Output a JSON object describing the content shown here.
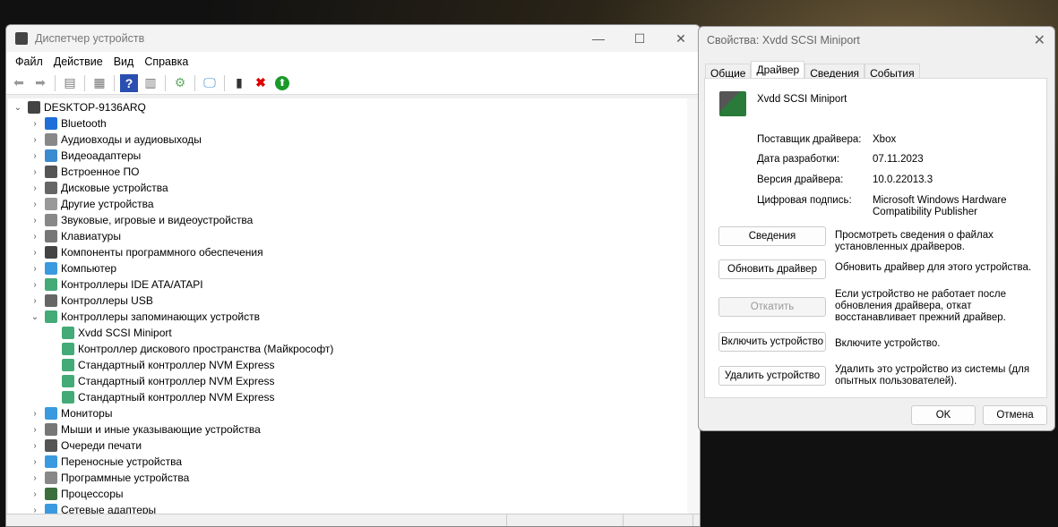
{
  "devmgr": {
    "title": "Диспетчер устройств",
    "menu": [
      "Файл",
      "Действие",
      "Вид",
      "Справка"
    ],
    "root": "DESKTOP-9136ARQ",
    "categories": [
      {
        "label": "Bluetooth",
        "icon": "bluetooth-icon",
        "color": "#1e6fd9"
      },
      {
        "label": "Аудиовходы и аудиовыходы",
        "icon": "speaker-icon",
        "color": "#888"
      },
      {
        "label": "Видеоадаптеры",
        "icon": "monitor-icon",
        "color": "#3a8bd0"
      },
      {
        "label": "Встроенное ПО",
        "icon": "chip-icon",
        "color": "#555"
      },
      {
        "label": "Дисковые устройства",
        "icon": "disk-icon",
        "color": "#666"
      },
      {
        "label": "Другие устройства",
        "icon": "unknown-device-icon",
        "color": "#999"
      },
      {
        "label": "Звуковые, игровые и видеоустройства",
        "icon": "speaker-icon",
        "color": "#888"
      },
      {
        "label": "Клавиатуры",
        "icon": "keyboard-icon",
        "color": "#777"
      },
      {
        "label": "Компоненты программного обеспечения",
        "icon": "software-icon",
        "color": "#444"
      },
      {
        "label": "Компьютер",
        "icon": "computer-icon",
        "color": "#3a9ae0"
      },
      {
        "label": "Контроллеры IDE ATA/ATAPI",
        "icon": "controller-icon",
        "color": "#4a7"
      },
      {
        "label": "Контроллеры USB",
        "icon": "usb-icon",
        "color": "#666"
      },
      {
        "label": "Контроллеры запоминающих устройств",
        "icon": "storage-controller-icon",
        "color": "#4a7",
        "expanded": true
      },
      {
        "label": "Мониторы",
        "icon": "monitor-icon",
        "color": "#3a9ae0"
      },
      {
        "label": "Мыши и иные указывающие устройства",
        "icon": "mouse-icon",
        "color": "#777"
      },
      {
        "label": "Очереди печати",
        "icon": "printer-icon",
        "color": "#555"
      },
      {
        "label": "Переносные устройства",
        "icon": "portable-device-icon",
        "color": "#3a9ae0"
      },
      {
        "label": "Программные устройства",
        "icon": "software-device-icon",
        "color": "#888"
      },
      {
        "label": "Процессоры",
        "icon": "cpu-icon",
        "color": "#3c6e3c"
      },
      {
        "label": "Сетевые адаптеры",
        "icon": "network-icon",
        "color": "#3a9ae0"
      }
    ],
    "storage_children": [
      "Xvdd SCSI Miniport",
      "Контроллер дискового пространства (Майкрософт)",
      "Стандартный контроллер NVM Express",
      "Стандартный контроллер NVM Express",
      "Стандартный контроллер NVM Express"
    ]
  },
  "props": {
    "title": "Свойства: Xvdd SCSI Miniport",
    "tabs": [
      "Общие",
      "Драйвер",
      "Сведения",
      "События"
    ],
    "active_tab": "Драйвер",
    "device_name": "Xvdd SCSI Miniport",
    "fields": [
      {
        "label": "Поставщик драйвера:",
        "value": "Xbox"
      },
      {
        "label": "Дата разработки:",
        "value": "07.11.2023"
      },
      {
        "label": "Версия драйвера:",
        "value": "10.0.22013.3"
      },
      {
        "label": "Цифровая подпись:",
        "value": "Microsoft Windows Hardware Compatibility Publisher"
      }
    ],
    "actions": [
      {
        "button": "Сведения",
        "desc": "Просмотреть сведения о файлах установленных драйверов."
      },
      {
        "button": "Обновить драйвер",
        "desc": "Обновить драйвер для этого устройства."
      },
      {
        "button": "Откатить",
        "desc": "Если устройство не работает после обновления драйвера, откат восстанавливает прежний драйвер.",
        "disabled": true
      },
      {
        "button": "Включить устройство",
        "desc": "Включите устройство."
      },
      {
        "button": "Удалить устройство",
        "desc": "Удалить это устройство из системы (для опытных пользователей)."
      }
    ],
    "ok": "OK",
    "cancel": "Отмена"
  }
}
